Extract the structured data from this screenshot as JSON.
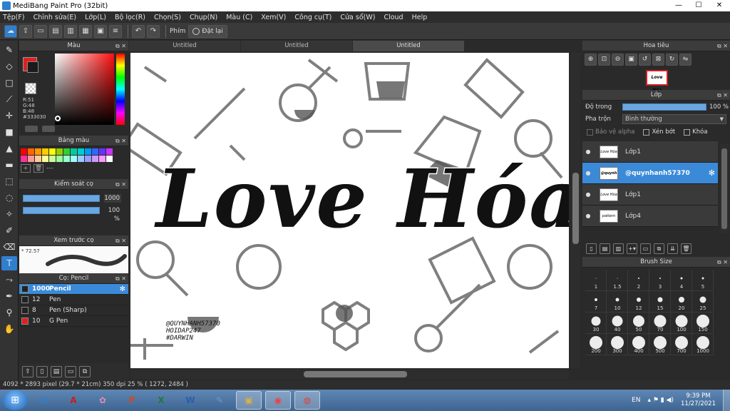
{
  "window": {
    "title": "MediBang Paint Pro (32bit)",
    "minimize": "—",
    "maximize": "☐",
    "close": "✕"
  },
  "menu": [
    "Tệp(F)",
    "Chỉnh sửa(E)",
    "Lớp(L)",
    "Bộ lọc(R)",
    "Chọn(S)",
    "Chụp(N)",
    "Màu (C)",
    "Xem(V)",
    "Công cụ(T)",
    "Cửa sổ(W)",
    "Cloud",
    "Help"
  ],
  "toolbar": {
    "key_label": "Phím",
    "reset_label": "Đặt lại"
  },
  "tools": [
    "brush-icon",
    "eraser-icon",
    "rect-icon",
    "line-icon",
    "move-icon",
    "fill-rect-icon",
    "bucket-icon",
    "gradient-icon",
    "select-rect-icon",
    "lasso-icon",
    "magic-wand-icon",
    "select-pen-icon",
    "select-eraser-icon",
    "text-icon",
    "divider-icon",
    "eyedropper-icon",
    "dropper-icon",
    "hand-icon"
  ],
  "color_panel": {
    "title": "Màu",
    "r": "R:51",
    "g": "G:48",
    "b": "B:48",
    "hex": "#333030"
  },
  "palette_panel": {
    "title": "Bảng màu",
    "extra": "---",
    "colors": [
      "#ff0000",
      "#ff6600",
      "#ff9900",
      "#ffcc00",
      "#ffff00",
      "#99cc00",
      "#33cc33",
      "#00cc99",
      "#00cccc",
      "#0099ff",
      "#3366ff",
      "#6633ff",
      "#cc33ff",
      "#ff3399",
      "#ff9999",
      "#ffcc99",
      "#ffff99",
      "#ccff99",
      "#99ff99",
      "#99ffcc",
      "#99ffff",
      "#99ccff",
      "#9999ff",
      "#cc99ff",
      "#ff99ff",
      "#ffffff"
    ]
  },
  "brush_control": {
    "title": "Kiểm soát cọ",
    "size": "1000",
    "opacity": "100 %",
    "size_fill": 1.0,
    "opacity_fill": 1.0
  },
  "brush_preview": {
    "title": "Xem trước cọ",
    "value": "* 72.57"
  },
  "brush_list": {
    "title": "Cọ: Pencil",
    "items": [
      {
        "size": "1000",
        "name": "Pencil",
        "color": "#333030"
      },
      {
        "size": "12",
        "name": "Pen",
        "color": "#222222"
      },
      {
        "size": "8",
        "name": "Pen (Sharp)",
        "color": "#222222"
      },
      {
        "size": "10",
        "name": "G Pen",
        "color": "#e02020"
      }
    ]
  },
  "tabs": [
    "Untitled",
    "Untitled",
    "Untitled"
  ],
  "canvas": {
    "title_text": "Love Hóa",
    "watermark": [
      "@QUYNHANH57370",
      "HOIDAP247",
      "#DARWIN"
    ]
  },
  "navigator": {
    "title": "Hoa tiêu",
    "thumb_text": "Love Hóa"
  },
  "layer_panel": {
    "title": "Lớp",
    "opacity_label": "Độ trong",
    "opacity_value": "100 %",
    "opacity_fill": 1.0,
    "blend_label": "Pha trộn",
    "blend_value": "Bình thường",
    "protect_alpha": "Bảo vệ alpha",
    "clipping": "Xén bớt",
    "lock": "Khóa",
    "layers": [
      {
        "name": "Lớp1",
        "thumb": "Love Hóa"
      },
      {
        "name": "@quynhanh57370",
        "thumb": "@quynh"
      },
      {
        "name": "Lớp1",
        "thumb": "Love Hóa"
      },
      {
        "name": "Lớp4",
        "thumb": "pattern"
      }
    ]
  },
  "brush_size": {
    "title": "Brush Size",
    "sizes": [
      {
        "label": "1",
        "d": 1
      },
      {
        "label": "1.5",
        "d": 1
      },
      {
        "label": "2",
        "d": 2
      },
      {
        "label": "3",
        "d": 2
      },
      {
        "label": "4",
        "d": 3
      },
      {
        "label": "5",
        "d": 3
      },
      {
        "label": "7",
        "d": 4
      },
      {
        "label": "10",
        "d": 5
      },
      {
        "label": "12",
        "d": 6
      },
      {
        "label": "15",
        "d": 7
      },
      {
        "label": "20",
        "d": 8
      },
      {
        "label": "25",
        "d": 9
      },
      {
        "label": "30",
        "d": 13
      },
      {
        "label": "40",
        "d": 15
      },
      {
        "label": "50",
        "d": 16
      },
      {
        "label": "70",
        "d": 17
      },
      {
        "label": "100",
        "d": 17
      },
      {
        "label": "150",
        "d": 18
      },
      {
        "label": "200",
        "d": 18
      },
      {
        "label": "300",
        "d": 18
      },
      {
        "label": "400",
        "d": 18
      },
      {
        "label": "500",
        "d": 18
      },
      {
        "label": "700",
        "d": 18
      },
      {
        "label": "1000",
        "d": 18
      }
    ]
  },
  "status": {
    "text": "4092 * 2893 pixel   (29.7 * 21cm)   350 dpi   25 %   ( 1272, 2484 )"
  },
  "taskbar": {
    "apps": [
      {
        "name": "ie-icon",
        "glyph": "e",
        "color": "#2b7fd0"
      },
      {
        "name": "acrobat-icon",
        "glyph": "A",
        "color": "#c81e1e"
      },
      {
        "name": "app-icon",
        "glyph": "✿",
        "color": "#e08cb0"
      },
      {
        "name": "powerpoint-icon",
        "glyph": "P",
        "color": "#d2481e"
      },
      {
        "name": "excel-icon",
        "glyph": "X",
        "color": "#1e7a3c"
      },
      {
        "name": "word-icon",
        "glyph": "W",
        "color": "#2b5eaa"
      },
      {
        "name": "paint-icon",
        "glyph": "✎",
        "color": "#6a9ad0"
      },
      {
        "name": "explorer-icon",
        "glyph": "▣",
        "color": "#e0b040"
      },
      {
        "name": "medibang-icon",
        "glyph": "◉",
        "color": "#f04040"
      },
      {
        "name": "chrome-icon",
        "glyph": "◍",
        "color": "#e04030"
      }
    ],
    "lang": "EN",
    "time": "9:39 PM",
    "date": "11/27/2021"
  }
}
